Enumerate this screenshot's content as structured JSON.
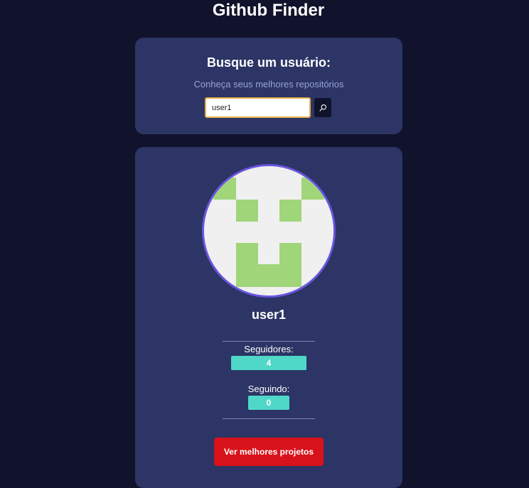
{
  "header": {
    "title": "Github Finder"
  },
  "search": {
    "heading": "Busque um usuário:",
    "subtitle": "Conheça seus melhores repositórios",
    "value": "user1",
    "button_icon": "search-icon"
  },
  "profile": {
    "username": "user1",
    "followers_label": "Seguidores:",
    "followers_count": "4",
    "following_label": "Seguindo:",
    "following_count": "0",
    "projects_button": "Ver melhores projetos"
  },
  "colors": {
    "page_background": "#10132b",
    "card_background": "#2c3565",
    "avatar_border": "#6a56e0",
    "avatar_pattern": "#a0d57a",
    "badge": "#4fd8c8",
    "primary_button": "#d8121b",
    "input_focus_border": "#e6b04a"
  }
}
